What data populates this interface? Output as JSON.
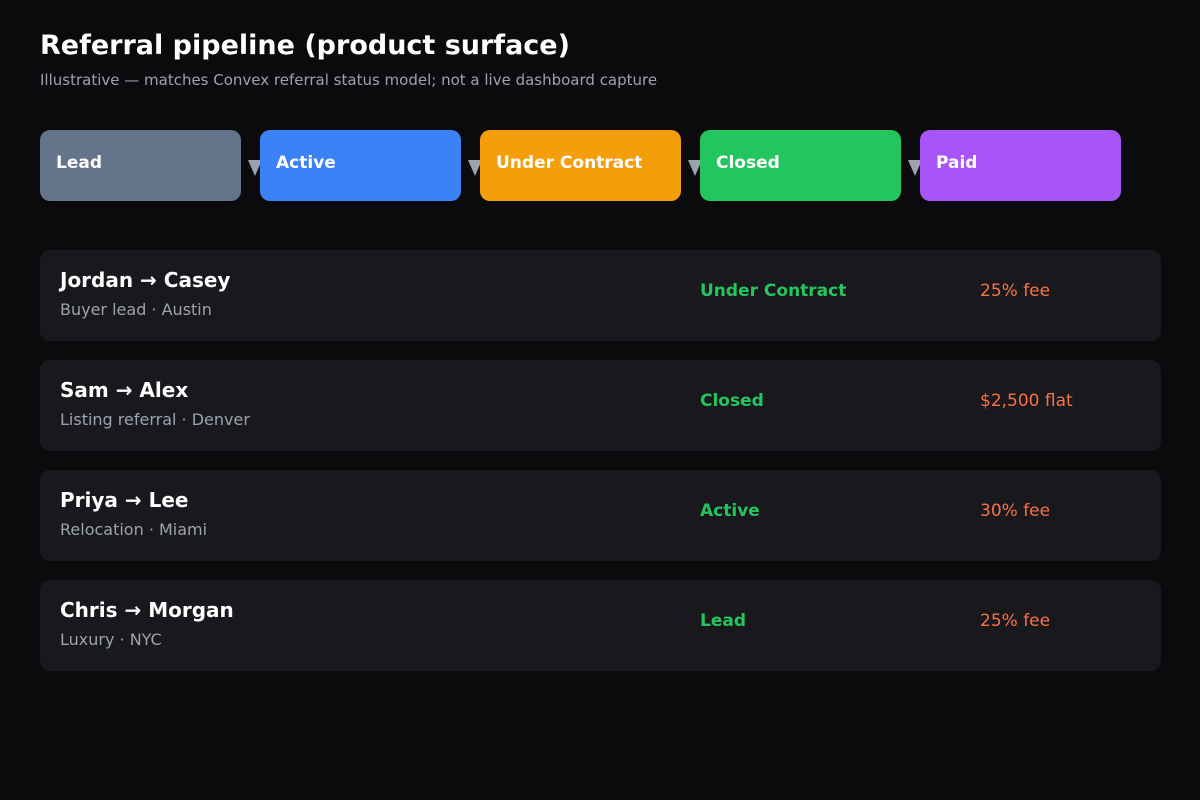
{
  "header": {
    "title": "Referral pipeline (product surface)",
    "subtitle": "Illustrative — matches Convex referral status model; not a live dashboard capture"
  },
  "pipeline": {
    "stages": [
      {
        "label": "Lead",
        "color": "#64748b"
      },
      {
        "label": "Active",
        "color": "#3b82f6"
      },
      {
        "label": "Under Contract",
        "color": "#f59e0b"
      },
      {
        "label": "Closed",
        "color": "#22c55e"
      },
      {
        "label": "Paid",
        "color": "#a855f7"
      }
    ],
    "arrow_icon": "chevron-right-icon"
  },
  "referrals": [
    {
      "names": "Jordan → Casey",
      "details": "Buyer lead · Austin",
      "status": "Under Contract",
      "fee": "25% fee"
    },
    {
      "names": "Sam → Alex",
      "details": "Listing referral · Denver",
      "status": "Closed",
      "fee": "$2,500 flat"
    },
    {
      "names": "Priya → Lee",
      "details": "Relocation · Miami",
      "status": "Active",
      "fee": "30% fee"
    },
    {
      "names": "Chris → Morgan",
      "details": "Luxury · NYC",
      "status": "Lead",
      "fee": "25% fee"
    }
  ],
  "colors": {
    "background": "#0b0b0e",
    "card": "#18181d",
    "status_text": "#22c55e",
    "fee_text": "#f97346",
    "muted_text": "#9ca3af"
  }
}
